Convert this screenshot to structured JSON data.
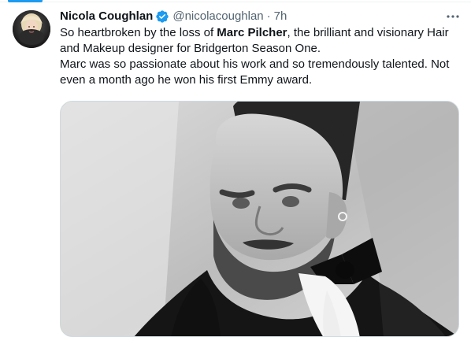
{
  "tweet": {
    "display_name": "Nicola Coughlan",
    "verified": true,
    "handle": "@nicolacoughlan",
    "separator": "·",
    "time": "7h",
    "text": {
      "line1_prefix": "So heartbroken by the loss of ",
      "line1_bold": "Marc Pilcher",
      "line1_suffix": ", the brilliant and visionary Hair and Makeup designer for Bridgerton Season One.",
      "line2": "Marc was so passionate about his work and so tremendously talented.  Not even a month ago he won his first Emmy award."
    }
  },
  "icons": {
    "avatar": "avatar",
    "verified": "verified-icon",
    "more": "more-icon"
  },
  "colors": {
    "accent": "#1d9bf0",
    "text_primary": "#0f1419",
    "text_secondary": "#536471",
    "border": "#cfd9de"
  }
}
